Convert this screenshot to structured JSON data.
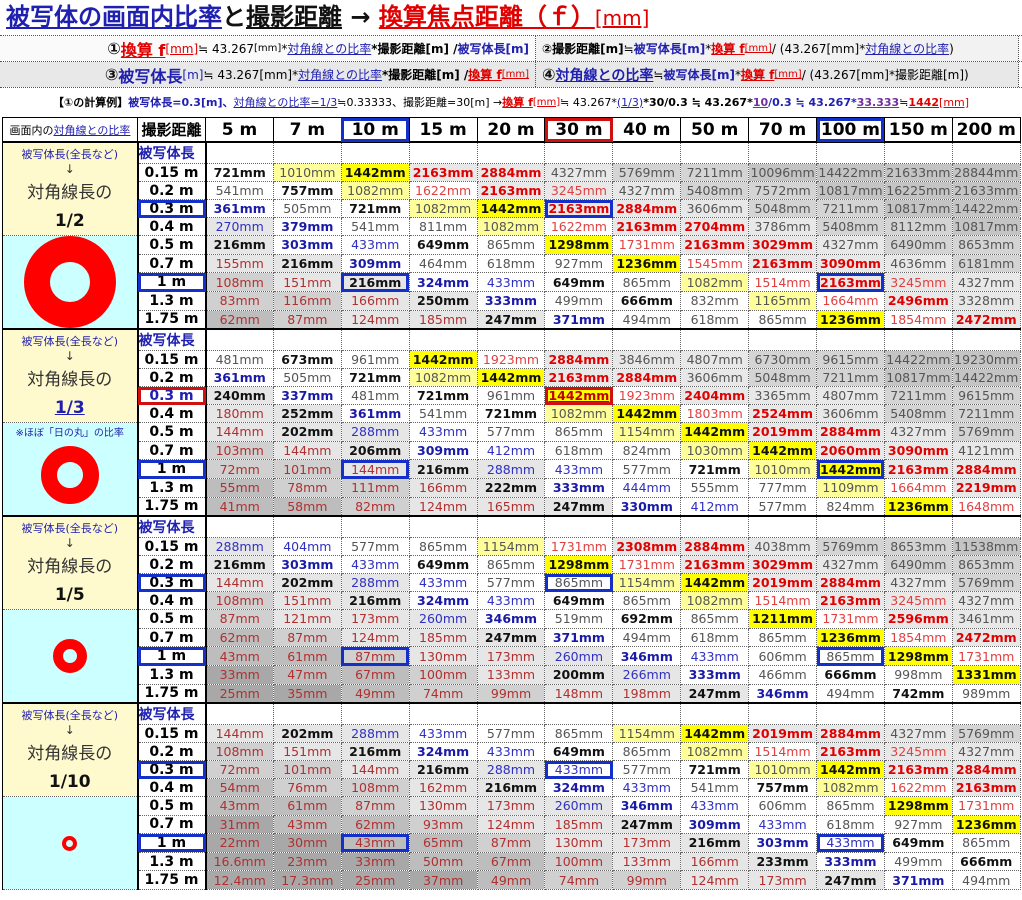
{
  "title": {
    "part1": "被写体の画面内比率",
    "part2": "と",
    "part3": "撮影距離",
    "arrow": " → ",
    "part4": "換算焦点距離（ｆ）",
    "unit": "[mm]"
  },
  "formulas": {
    "f1": {
      "num": "①",
      "a": "換算 f",
      "a_unit": "[mm]",
      "b": " ≒ 43.267",
      "b_unit": "[mm]",
      "c": "*",
      "d": "対角線との比率",
      "e": "*撮影距離[m] / ",
      "g": "被写体長[m]"
    },
    "f2": {
      "num": "②",
      "a": "撮影距離[m]",
      "b": " ≒ ",
      "c": "被写体長[m]",
      "d": "*",
      "e": "換算 f",
      "e_unit": "[mm]",
      "g": " / (43.267[mm]*",
      "h": "対角線との比率",
      "i": ")"
    },
    "f3": {
      "num": "③",
      "a": "被写体長",
      "a_unit": "[m]",
      "b": " ≒ 43.267[mm]*",
      "c": "対角線との比率",
      "d": "*撮影距離[m] / ",
      "e": "換算 f",
      "e_unit": "[mm]"
    },
    "f4": {
      "num": "④",
      "a": "対角線との比率",
      "b": " ≒ ",
      "c": "被写体長[m]",
      "d": "*",
      "e": "換算 f",
      "e_unit": "[mm]",
      "g": " / (43.267[mm]*撮影距離[m])"
    }
  },
  "example": {
    "a": "【①の計算例】",
    "b": "被写体長=0.3[m]、",
    "c": "対角線との比率=1/3",
    "d": "≒0.33333、撮影距離=30[m] → ",
    "e": "換算 f",
    "e_unit": "[mm]",
    "g": " ≒ 43.267*",
    "h": "(1/3)",
    "i": "*30/0.3 ≒ 43.267*",
    "j": "10",
    "k": "/0.3 ≒ 43.267*",
    "l": "33.333",
    "m": " ≒ ",
    "n": "1442",
    "n_unit": "[mm]"
  },
  "header": {
    "ratio_label_a": "画面内の",
    "ratio_label_b": "対角線との比率",
    "distance_label": "撮影距離",
    "distances": [
      "5 m",
      "7 m",
      "10 m",
      "15 m",
      "20 m",
      "30 m",
      "40 m",
      "50 m",
      "70 m",
      "100 m",
      "150 m",
      "200 m"
    ]
  },
  "subject_lengths": [
    "0.15 m",
    "0.2 m",
    "0.3 m",
    "0.4 m",
    "0.5 m",
    "0.7 m",
    "1 m",
    "1.3 m",
    "1.75 m"
  ],
  "blocks": [
    {
      "side_top": "被写体長(全長など)",
      "arrow": "↓",
      "side_label": "対角線長の",
      "ratio": "1/2",
      "note": "",
      "col_label": "被写体長",
      "values": [
        [
          "721",
          "1010",
          "1442",
          "2163",
          "2884",
          "4327",
          "5769",
          "7211",
          "10096",
          "14422",
          "21633",
          "28844"
        ],
        [
          "541",
          "757",
          "1082",
          "1622",
          "2163",
          "3245",
          "4327",
          "5408",
          "7572",
          "10817",
          "16225",
          "21633"
        ],
        [
          "361",
          "505",
          "721",
          "1082",
          "1442",
          "2163",
          "2884",
          "3606",
          "5048",
          "7211",
          "10817",
          "14422"
        ],
        [
          "270",
          "379",
          "541",
          "811",
          "1082",
          "1622",
          "2163",
          "2704",
          "3786",
          "5408",
          "8112",
          "10817"
        ],
        [
          "216",
          "303",
          "433",
          "649",
          "865",
          "1298",
          "1731",
          "2163",
          "3029",
          "4327",
          "6490",
          "8653"
        ],
        [
          "155",
          "216",
          "309",
          "464",
          "618",
          "927",
          "1236",
          "1545",
          "2163",
          "3090",
          "4636",
          "6181"
        ],
        [
          "108",
          "151",
          "216",
          "324",
          "433",
          "649",
          "865",
          "1082",
          "1514",
          "2163",
          "3245",
          "4327"
        ],
        [
          "83",
          "116",
          "166",
          "250",
          "333",
          "499",
          "666",
          "832",
          "1165",
          "1664",
          "2496",
          "3328"
        ],
        [
          "62",
          "87",
          "124",
          "185",
          "247",
          "371",
          "494",
          "618",
          "865",
          "1236",
          "1854",
          "2472"
        ]
      ]
    },
    {
      "side_top": "被写体長(全長など)",
      "arrow": "↓",
      "side_label": "対角線長の",
      "ratio": "1/3",
      "note": "※ほぼ「日の丸」の比率",
      "col_label": "被写体長",
      "values": [
        [
          "481",
          "673",
          "961",
          "1442",
          "1923",
          "2884",
          "3846",
          "4807",
          "6730",
          "9615",
          "14422",
          "19230"
        ],
        [
          "361",
          "505",
          "721",
          "1082",
          "1442",
          "2163",
          "2884",
          "3606",
          "5048",
          "7211",
          "10817",
          "14422"
        ],
        [
          "240",
          "337",
          "481",
          "721",
          "961",
          "1442",
          "1923",
          "2404",
          "3365",
          "4807",
          "7211",
          "9615"
        ],
        [
          "180",
          "252",
          "361",
          "541",
          "721",
          "1082",
          "1442",
          "1803",
          "2524",
          "3606",
          "5408",
          "7211"
        ],
        [
          "144",
          "202",
          "288",
          "433",
          "577",
          "865",
          "1154",
          "1442",
          "2019",
          "2884",
          "4327",
          "5769"
        ],
        [
          "103",
          "144",
          "206",
          "309",
          "412",
          "618",
          "824",
          "1030",
          "1442",
          "2060",
          "3090",
          "4121"
        ],
        [
          "72",
          "101",
          "144",
          "216",
          "288",
          "433",
          "577",
          "721",
          "1010",
          "1442",
          "2163",
          "2884"
        ],
        [
          "55",
          "78",
          "111",
          "166",
          "222",
          "333",
          "444",
          "555",
          "777",
          "1109",
          "1664",
          "2219"
        ],
        [
          "41",
          "58",
          "82",
          "124",
          "165",
          "247",
          "330",
          "412",
          "577",
          "824",
          "1236",
          "1648"
        ]
      ]
    },
    {
      "side_top": "被写体長(全長など)",
      "arrow": "↓",
      "side_label": "対角線長の",
      "ratio": "1/5",
      "note": "",
      "col_label": "被写体長",
      "values": [
        [
          "288",
          "404",
          "577",
          "865",
          "1154",
          "1731",
          "2308",
          "2884",
          "4038",
          "5769",
          "8653",
          "11538"
        ],
        [
          "216",
          "303",
          "433",
          "649",
          "865",
          "1298",
          "1731",
          "2163",
          "3029",
          "4327",
          "6490",
          "8653"
        ],
        [
          "144",
          "202",
          "288",
          "433",
          "577",
          "865",
          "1154",
          "1442",
          "2019",
          "2884",
          "4327",
          "5769"
        ],
        [
          "108",
          "151",
          "216",
          "324",
          "433",
          "649",
          "865",
          "1082",
          "1514",
          "2163",
          "3245",
          "4327"
        ],
        [
          "87",
          "121",
          "173",
          "260",
          "346",
          "519",
          "692",
          "865",
          "1211",
          "1731",
          "2596",
          "3461"
        ],
        [
          "62",
          "87",
          "124",
          "185",
          "247",
          "371",
          "494",
          "618",
          "865",
          "1236",
          "1854",
          "2472"
        ],
        [
          "43",
          "61",
          "87",
          "130",
          "173",
          "260",
          "346",
          "433",
          "606",
          "865",
          "1298",
          "1731"
        ],
        [
          "33",
          "47",
          "67",
          "100",
          "133",
          "200",
          "266",
          "333",
          "466",
          "666",
          "998",
          "1331"
        ],
        [
          "25",
          "35",
          "49",
          "74",
          "99",
          "148",
          "198",
          "247",
          "346",
          "494",
          "742",
          "989"
        ]
      ]
    },
    {
      "side_top": "被写体長(全長など)",
      "arrow": "↓",
      "side_label": "対角線長の",
      "ratio": "1/10",
      "note": "",
      "col_label": "被写体長",
      "values": [
        [
          "144",
          "202",
          "288",
          "433",
          "577",
          "865",
          "1154",
          "1442",
          "2019",
          "2884",
          "4327",
          "5769"
        ],
        [
          "108",
          "151",
          "216",
          "324",
          "433",
          "649",
          "865",
          "1082",
          "1514",
          "2163",
          "3245",
          "4327"
        ],
        [
          "72",
          "101",
          "144",
          "216",
          "288",
          "433",
          "577",
          "721",
          "1010",
          "1442",
          "2163",
          "2884"
        ],
        [
          "54",
          "76",
          "108",
          "162",
          "216",
          "324",
          "433",
          "541",
          "757",
          "1082",
          "1622",
          "2163"
        ],
        [
          "43",
          "61",
          "87",
          "130",
          "173",
          "260",
          "346",
          "433",
          "606",
          "865",
          "1298",
          "1731"
        ],
        [
          "31",
          "43",
          "62",
          "93",
          "124",
          "185",
          "247",
          "309",
          "433",
          "618",
          "927",
          "1236"
        ],
        [
          "22",
          "30",
          "43",
          "65",
          "87",
          "130",
          "173",
          "216",
          "303",
          "433",
          "649",
          "865"
        ],
        [
          "16.6",
          "23",
          "33",
          "50",
          "67",
          "100",
          "133",
          "166",
          "233",
          "333",
          "499",
          "666"
        ],
        [
          "12.4",
          "17.3",
          "25",
          "37",
          "49",
          "74",
          "99",
          "124",
          "173",
          "247",
          "371",
          "494"
        ]
      ]
    }
  ],
  "unit_suffix": "mm",
  "colors": {
    "accent_blue": "#1f1fb0",
    "accent_red": "#e00000",
    "yellow": "#ffff00",
    "light_yellow": "#ffff99",
    "cyan_bg": "#ccffff",
    "side_yellow_bg": "#fffacd",
    "ring": "#ff0000"
  }
}
